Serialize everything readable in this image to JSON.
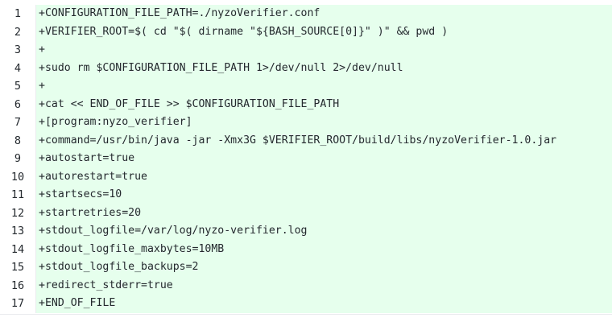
{
  "diff": {
    "lines": [
      {
        "num": "1",
        "text": "+CONFIGURATION_FILE_PATH=./nyzoVerifier.conf"
      },
      {
        "num": "2",
        "text": "+VERIFIER_ROOT=$( cd \"$( dirname \"${BASH_SOURCE[0]}\" )\" && pwd )"
      },
      {
        "num": "3",
        "text": "+"
      },
      {
        "num": "4",
        "text": "+sudo rm $CONFIGURATION_FILE_PATH 1>/dev/null 2>/dev/null"
      },
      {
        "num": "5",
        "text": "+"
      },
      {
        "num": "6",
        "text": "+cat << END_OF_FILE >> $CONFIGURATION_FILE_PATH"
      },
      {
        "num": "7",
        "text": "+[program:nyzo_verifier]"
      },
      {
        "num": "8",
        "text": "+command=/usr/bin/java -jar -Xmx3G $VERIFIER_ROOT/build/libs/nyzoVerifier-1.0.jar"
      },
      {
        "num": "9",
        "text": "+autostart=true"
      },
      {
        "num": "10",
        "text": "+autorestart=true"
      },
      {
        "num": "11",
        "text": "+startsecs=10"
      },
      {
        "num": "12",
        "text": "+startretries=20"
      },
      {
        "num": "13",
        "text": "+stdout_logfile=/var/log/nyzo-verifier.log"
      },
      {
        "num": "14",
        "text": "+stdout_logfile_maxbytes=10MB"
      },
      {
        "num": "15",
        "text": "+stdout_logfile_backups=2"
      },
      {
        "num": "16",
        "text": "+redirect_stderr=true"
      },
      {
        "num": "17",
        "text": "+END_OF_FILE"
      }
    ]
  },
  "colors": {
    "added_line_background": "#e6ffed",
    "gutter_background": "#ffffff",
    "text": "#24292e"
  }
}
